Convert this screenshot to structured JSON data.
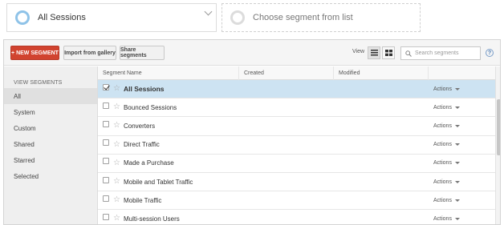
{
  "segments_bar": {
    "active_segment": "All Sessions",
    "empty_slot": "Choose segment from list"
  },
  "toolbar": {
    "new_segment": "+ NEW SEGMENT",
    "import_from_gallery": "Import from gallery",
    "share_segments": "Share segments",
    "view_label": "View",
    "search_placeholder": "Search segments",
    "help": "?"
  },
  "sidebar": {
    "heading": "VIEW SEGMENTS",
    "items": [
      {
        "label": "All",
        "selected": true
      },
      {
        "label": "System"
      },
      {
        "label": "Custom"
      },
      {
        "label": "Shared"
      },
      {
        "label": "Starred"
      },
      {
        "label": "Selected"
      }
    ]
  },
  "table": {
    "headers": {
      "name": "Segment Name",
      "created": "Created",
      "modified": "Modified",
      "actions": ""
    },
    "actions_label": "Actions",
    "rows": [
      {
        "name": "All Sessions",
        "checked": true
      },
      {
        "name": "Bounced Sessions",
        "checked": false
      },
      {
        "name": "Converters",
        "checked": false
      },
      {
        "name": "Direct Traffic",
        "checked": false
      },
      {
        "name": "Made a Purchase",
        "checked": false
      },
      {
        "name": "Mobile and Tablet Traffic",
        "checked": false
      },
      {
        "name": "Mobile Traffic",
        "checked": false
      },
      {
        "name": "Multi-session Users",
        "checked": false
      }
    ]
  },
  "icons": {
    "star": "star-outline-icon",
    "list_view": "list-view-icon",
    "grid_view": "grid-view-icon",
    "search": "search-icon"
  },
  "colors": {
    "accent_red": "#d1432f",
    "selected_row": "#cde3f2",
    "segment_circle": "#8fc3e8"
  }
}
